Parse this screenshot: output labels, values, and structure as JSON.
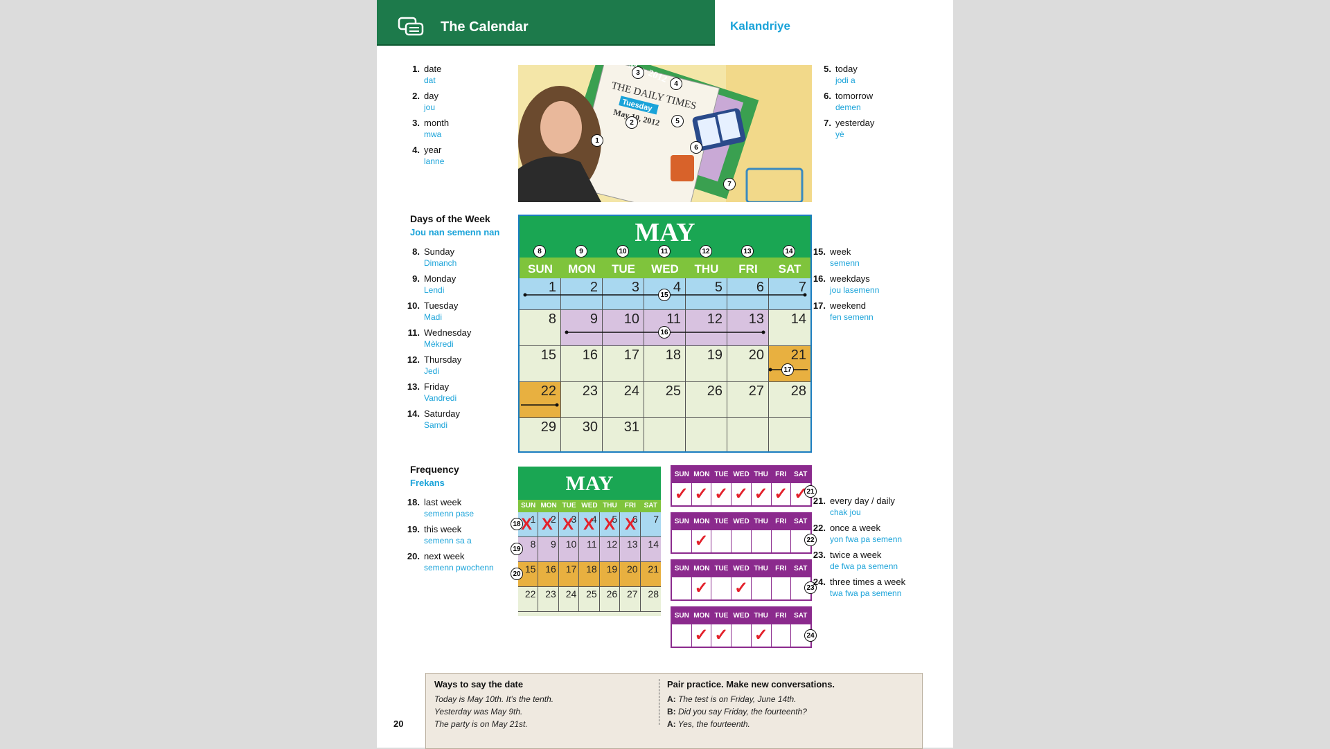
{
  "header": {
    "title": "The Calendar",
    "subtitle": "Kalandriye"
  },
  "vocab_top_left": [
    {
      "num": "1.",
      "en": "date",
      "tr": "dat"
    },
    {
      "num": "2.",
      "en": "day",
      "tr": "jou"
    },
    {
      "num": "3.",
      "en": "month",
      "tr": "mwa"
    },
    {
      "num": "4.",
      "en": "year",
      "tr": "lanne"
    }
  ],
  "vocab_top_right": [
    {
      "num": "5.",
      "en": "today",
      "tr": "jodi a"
    },
    {
      "num": "6.",
      "en": "tomorrow",
      "tr": "demen"
    },
    {
      "num": "7.",
      "en": "yesterday",
      "tr": "yè"
    }
  ],
  "illustration": {
    "newspaper": "THE DAILY TIMES",
    "day": "Tuesday",
    "date": "May 10, 2012",
    "calendar": "May 2012",
    "callouts": [
      "1",
      "2",
      "3",
      "4",
      "5",
      "6",
      "7"
    ]
  },
  "days_section": {
    "title": "Days of the Week",
    "subtitle": "Jou nan semenn nan"
  },
  "vocab_days": [
    {
      "num": "8.",
      "en": "Sunday",
      "tr": "Dimanch"
    },
    {
      "num": "9.",
      "en": "Monday",
      "tr": "Lendi"
    },
    {
      "num": "10.",
      "en": "Tuesday",
      "tr": "Madi"
    },
    {
      "num": "11.",
      "en": "Wednesday",
      "tr": "Mèkredi"
    },
    {
      "num": "12.",
      "en": "Thursday",
      "tr": "Jedi"
    },
    {
      "num": "13.",
      "en": "Friday",
      "tr": "Vandredi"
    },
    {
      "num": "14.",
      "en": "Saturday",
      "tr": "Samdi"
    }
  ],
  "vocab_week": [
    {
      "num": "15.",
      "en": "week",
      "tr": "semenn"
    },
    {
      "num": "16.",
      "en": "weekdays",
      "tr": "jou lasemenn"
    },
    {
      "num": "17.",
      "en": "weekend",
      "tr": "fen semenn"
    }
  ],
  "big_calendar": {
    "month": "MAY",
    "day_callouts": [
      "8",
      "9",
      "10",
      "11",
      "12",
      "13",
      "14"
    ],
    "days": [
      "SUN",
      "MON",
      "TUE",
      "WED",
      "THU",
      "FRI",
      "SAT"
    ],
    "weeks": [
      [
        "",
        "1",
        "2",
        "3",
        "4",
        "5",
        "6",
        "7"
      ],
      [
        "8",
        "9",
        "10",
        "11",
        "12",
        "13",
        "14"
      ],
      [
        "15",
        "16",
        "17",
        "18",
        "19",
        "20",
        "21"
      ],
      [
        "22",
        "23",
        "24",
        "25",
        "26",
        "27",
        "28"
      ],
      [
        "29",
        "30",
        "31",
        "",
        "",
        "",
        ""
      ]
    ],
    "callouts": {
      "week": "15",
      "weekdays": "16",
      "weekend": "17"
    }
  },
  "frequency_section": {
    "title": "Frequency",
    "subtitle": "Frekans"
  },
  "vocab_freq_left": [
    {
      "num": "18.",
      "en": "last week",
      "tr": "semenn pase"
    },
    {
      "num": "19.",
      "en": "this week",
      "tr": "semenn sa a"
    },
    {
      "num": "20.",
      "en": "next week",
      "tr": "semenn pwochenn"
    }
  ],
  "vocab_freq_right": [
    {
      "num": "21.",
      "en": "every day / daily",
      "tr": "chak jou"
    },
    {
      "num": "22.",
      "en": "once a week",
      "tr": "yon fwa pa semenn"
    },
    {
      "num": "23.",
      "en": "twice a week",
      "tr": "de fwa pa semenn"
    },
    {
      "num": "24.",
      "en": "three times a week",
      "tr": "twa fwa pa semenn"
    }
  ],
  "small_calendar": {
    "month": "MAY",
    "days": [
      "SUN",
      "MON",
      "TUE",
      "WED",
      "THU",
      "FRI",
      "SAT"
    ],
    "weeks": [
      [
        "1",
        "2",
        "3",
        "4",
        "5",
        "6",
        "7"
      ],
      [
        "8",
        "9",
        "10",
        "11",
        "12",
        "13",
        "14"
      ],
      [
        "15",
        "16",
        "17",
        "18",
        "19",
        "20",
        "21"
      ],
      [
        "22",
        "23",
        "24",
        "25",
        "26",
        "27",
        "28"
      ]
    ],
    "callouts": [
      "18",
      "19",
      "20"
    ],
    "mark": "X"
  },
  "frequency_strips": [
    {
      "callout": "21",
      "checks": [
        1,
        1,
        1,
        1,
        1,
        1,
        1
      ]
    },
    {
      "callout": "22",
      "checks": [
        0,
        1,
        0,
        0,
        0,
        0,
        0
      ]
    },
    {
      "callout": "23",
      "checks": [
        0,
        1,
        0,
        1,
        0,
        0,
        0
      ]
    },
    {
      "callout": "24",
      "checks": [
        0,
        1,
        1,
        0,
        1,
        0,
        0
      ]
    }
  ],
  "strip_days": [
    "SUN",
    "MON",
    "TUE",
    "WED",
    "THU",
    "FRI",
    "SAT"
  ],
  "check_mark": "✓",
  "notes": {
    "left_title": "Ways to say the date",
    "left_lines": [
      "Today is May 10th. It’s the tenth.",
      "Yesterday was May 9th.",
      "The party is on May 21st."
    ],
    "right_title": "Pair practice. Make new conversations.",
    "right_lines": [
      {
        "speaker": "A:",
        "text": "The test is on Friday, June 14th."
      },
      {
        "speaker": "B:",
        "text": "Did you say Friday, the fourteenth?"
      },
      {
        "speaker": "A:",
        "text": "Yes, the fourteenth."
      }
    ]
  },
  "page_number": "20",
  "colors": {
    "green": "#1aa653",
    "light_green": "#7fc43c",
    "blue": "#1aa3d9",
    "purple": "#8b2a8d",
    "orange": "#e8b040",
    "lavender": "#d8c2e0",
    "sky": "#a9d8f0",
    "red": "#e3212b"
  }
}
